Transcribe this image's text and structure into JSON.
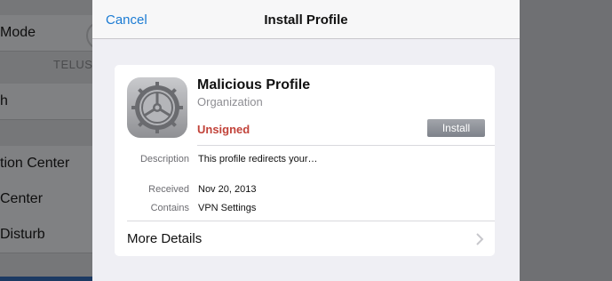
{
  "background": {
    "rows": [
      {
        "label": " Mode"
      },
      {
        "label": "h"
      },
      {
        "label": "tion Center"
      },
      {
        "label": "Center"
      },
      {
        "label": "Disturb"
      }
    ],
    "carrier": "TELUS"
  },
  "sheet": {
    "cancel_label": "Cancel",
    "title": "Install Profile"
  },
  "profile": {
    "icon": "settings-gear-icon",
    "name": "Malicious Profile",
    "organization": "Organization",
    "status": "Unsigned",
    "status_color": "#c2433a",
    "install_label": "Install",
    "details": [
      {
        "label": "Description",
        "value": "This profile redirects your…"
      },
      {
        "label": "Received",
        "value": "Nov 20, 2013"
      },
      {
        "label": "Contains",
        "value": "VPN Settings"
      }
    ],
    "more_details_label": "More Details"
  },
  "colors": {
    "link_blue": "#1b7bd3",
    "sheet_bg": "#efeff4",
    "dimmed_bg": "#6f7073"
  }
}
